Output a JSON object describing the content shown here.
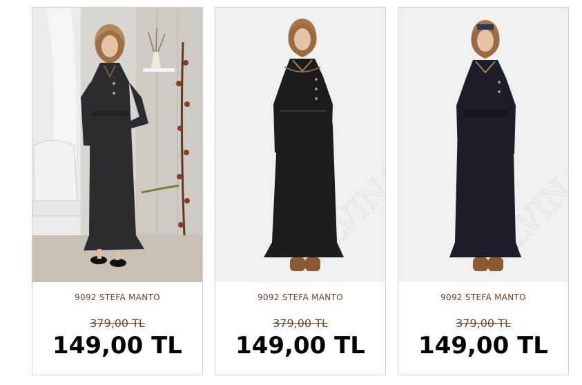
{
  "products": [
    {
      "name": "9092 STEFA MANTO",
      "old_price": "379,00 TL",
      "new_price": "149,00 TL"
    },
    {
      "name": "9092 STEFA MANTO",
      "old_price": "379,00 TL",
      "new_price": "149,00 TL",
      "watermark": "ALVINA"
    },
    {
      "name": "9092 STEFA MANTO",
      "old_price": "379,00 TL",
      "new_price": "149,00 TL",
      "watermark": "ALVINA"
    }
  ],
  "colors": {
    "card_border": "#d6cfc7",
    "name_text": "#6b3f2a",
    "old_price_text": "#6b3f2a",
    "new_price_text": "#000000"
  }
}
